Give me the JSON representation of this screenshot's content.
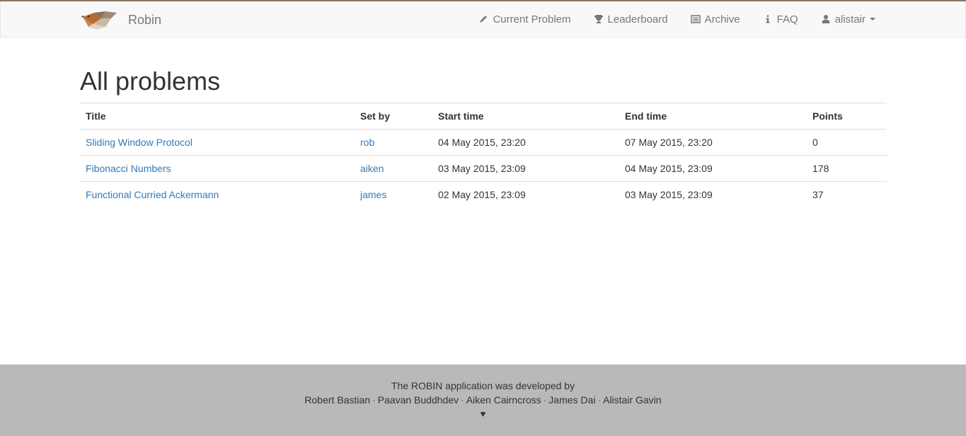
{
  "navbar": {
    "brand": "Robin",
    "items": [
      {
        "label": "Current Problem",
        "icon": "pencil-icon"
      },
      {
        "label": "Leaderboard",
        "icon": "trophy-icon"
      },
      {
        "label": "Archive",
        "icon": "list-alt-icon"
      },
      {
        "label": "FAQ",
        "icon": "info-icon"
      },
      {
        "label": "alistair",
        "icon": "user-icon"
      }
    ]
  },
  "page": {
    "title": "All problems"
  },
  "table": {
    "headers": [
      "Title",
      "Set by",
      "Start time",
      "End time",
      "Points"
    ],
    "rows": [
      {
        "title": "Sliding Window Protocol",
        "set_by": "rob",
        "start": "04 May 2015, 23:20",
        "end": "07 May 2015, 23:20",
        "points": "0"
      },
      {
        "title": "Fibonacci Numbers",
        "set_by": "aiken",
        "start": "03 May 2015, 23:09",
        "end": "04 May 2015, 23:09",
        "points": "178"
      },
      {
        "title": "Functional Curried Ackermann",
        "set_by": "james",
        "start": "02 May 2015, 23:09",
        "end": "03 May 2015, 23:09",
        "points": "37"
      }
    ]
  },
  "footer": {
    "line1": "The ROBIN application was developed by",
    "developers": [
      "Robert Bastian",
      "Paavan Buddhdev",
      "Aiken Cairncross",
      "James Dai",
      "Alistair Gavin"
    ],
    "separator": "·",
    "heart": "♥"
  },
  "colors": {
    "link": "#337ab7",
    "navbar_bg": "#f8f8f8",
    "footer_bg": "#b9b9b9"
  }
}
